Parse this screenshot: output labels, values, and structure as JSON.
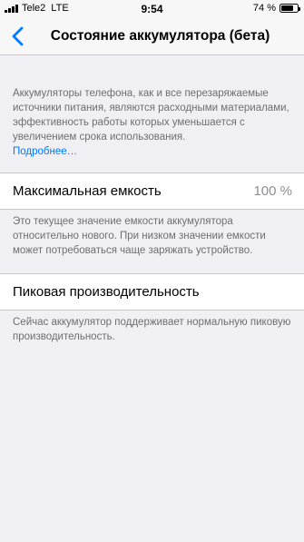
{
  "status_bar": {
    "carrier": "Tele2",
    "network": "LTE",
    "time": "9:54",
    "battery_percent_text": "74 %",
    "battery_level": 0.74
  },
  "nav": {
    "back_icon": "chevron-left-icon",
    "title": "Состояние аккумулятора (бета)"
  },
  "intro": {
    "text": "Аккумуляторы телефона, как и все перезаряжаемые источники питания, являются расходными материалами, эффективность работы которых уменьшается с увеличением срока использования.",
    "link": "Подробнее…"
  },
  "max_capacity": {
    "label": "Максимальная емкость",
    "value": "100 %",
    "footer": "Это текущее значение емкости аккумулятора относительно нового. При низком значении емкости может потребоваться чаще заряжать устройство."
  },
  "peak_performance": {
    "label": "Пиковая производительность",
    "footer": "Сейчас аккумулятор поддерживает нормальную пиковую производительность."
  },
  "colors": {
    "accent": "#007aff",
    "background": "#efeff4",
    "secondary_text": "#6d6d72"
  }
}
